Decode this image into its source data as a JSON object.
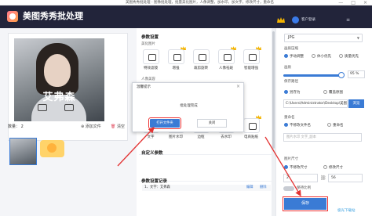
{
  "window": {
    "caption": "美图秀秀批处理 - 图像批处理，批量美化图片，人像调整，加水印，加文字，修改尺寸，重命名",
    "controls": [
      "—",
      "□",
      "×"
    ]
  },
  "header": {
    "app_title": "美图秀秀批处理",
    "login_label": "客户登录"
  },
  "preview": {
    "watermark_text": "艾弗森",
    "count_label": "数量：",
    "count_value": "2",
    "add_file_label": "添加文件",
    "clear_label": "清空"
  },
  "params": {
    "section_title": "参数设置",
    "group_beautify": "美化图片",
    "tools_row1": [
      "特效滤镜",
      "增强",
      "裁剪旋转",
      "人像祛斑",
      "智能增强"
    ],
    "group_portrait": "人像美容",
    "tools_row2": [
      "文字",
      "图片水印",
      "边框",
      "去水印",
      "电商贴纸"
    ],
    "custom_title": "自定义参数",
    "record_title": "参数设置记录",
    "record_desc": "1、文字：艾弗森",
    "record_edit": "编辑",
    "record_delete": "删除"
  },
  "dialog": {
    "title": "温馨提示",
    "message": "批处理完成",
    "open_button": "打开文件夹",
    "close_button": "关闭",
    "close_icon": "×"
  },
  "output": {
    "format_value": "JPG",
    "quality_label": "画质压缩",
    "quality_options": [
      "手动调整",
      "体小优先",
      "质量优先"
    ],
    "quality_selected": 0,
    "quality_percent_label": "画质",
    "quality_value": "95",
    "quality_unit": "%",
    "quality_fraction": 0.95,
    "save_path_label": "保存路径",
    "path_options": [
      "另存为",
      "覆盖原图"
    ],
    "path_selected": 0,
    "path_value": "C:\\Users\\Administrator\\Desktop\\美图批处理",
    "browse_button": "浏览",
    "rename_label": "重命名",
    "rename_options": [
      "不修改文件名",
      "重命名"
    ],
    "rename_selected": 0,
    "suffix_placeholder": "图片水印  文字_副本",
    "size_label": "图片尺寸",
    "size_options": [
      "不修改尺寸",
      "修改尺寸"
    ],
    "size_selected": 0,
    "width_value": "2",
    "height_value": "56",
    "toggle_label": "保持比例",
    "save_button": "保存"
  },
  "site_mark": "极光下载站",
  "colors": {
    "accent": "#3a7bd5",
    "header_bg": "#22243a",
    "arrow": "#e33333",
    "vip_gold": "#f4b400"
  }
}
